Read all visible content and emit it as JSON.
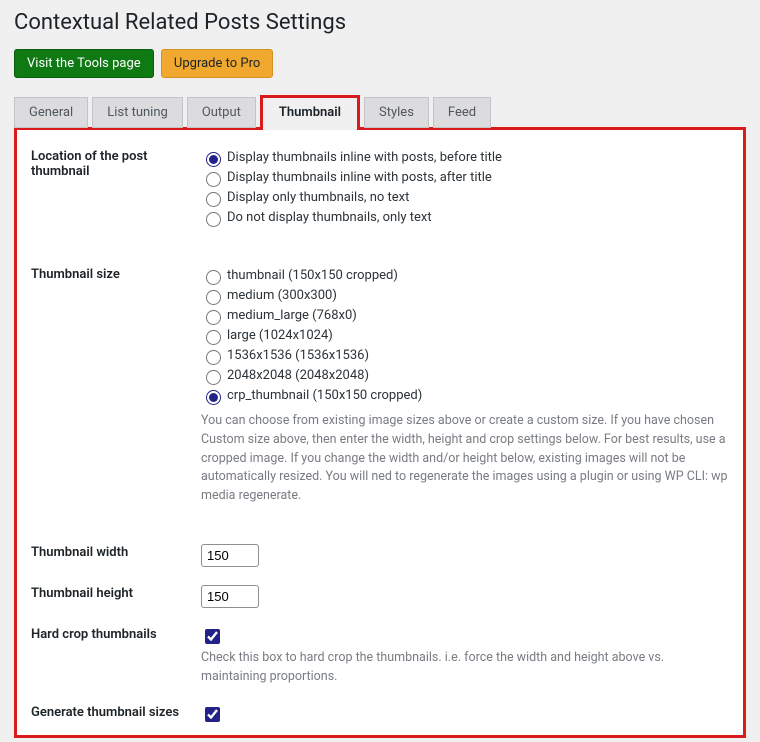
{
  "title": "Contextual Related Posts Settings",
  "buttons": {
    "visit_tools": "Visit the Tools page",
    "upgrade": "Upgrade to Pro"
  },
  "tabs": {
    "general": "General",
    "list_tuning": "List tuning",
    "output": "Output",
    "thumbnail": "Thumbnail",
    "styles": "Styles",
    "feed": "Feed"
  },
  "fields": {
    "location": {
      "label": "Location of the post thumbnail",
      "options": {
        "before": "Display thumbnails inline with posts, before title",
        "after": "Display thumbnails inline with posts, after title",
        "only_thumb": "Display only thumbnails, no text",
        "only_text": "Do not display thumbnails, only text"
      }
    },
    "size": {
      "label": "Thumbnail size",
      "options": {
        "thumbnail": "thumbnail (150x150 cropped)",
        "medium": "medium (300x300)",
        "medium_large": "medium_large (768x0)",
        "large": "large (1024x1024)",
        "s1536": "1536x1536 (1536x1536)",
        "s2048": "2048x2048 (2048x2048)",
        "crp": "crp_thumbnail (150x150 cropped)"
      },
      "desc": "You can choose from existing image sizes above or create a custom size. If you have chosen Custom size above, then enter the width, height and crop settings below. For best results, use a cropped image. If you change the width and/or height below, existing images will not be automatically resized. You will ned to regenerate the images using a plugin or using WP CLI: wp media regenerate."
    },
    "width": {
      "label": "Thumbnail width",
      "value": "150"
    },
    "height": {
      "label": "Thumbnail height",
      "value": "150"
    },
    "hardcrop": {
      "label": "Hard crop thumbnails",
      "desc": "Check this box to hard crop the thumbnails. i.e. force the width and height above vs. maintaining proportions."
    },
    "gen": {
      "label": "Generate thumbnail sizes"
    }
  }
}
